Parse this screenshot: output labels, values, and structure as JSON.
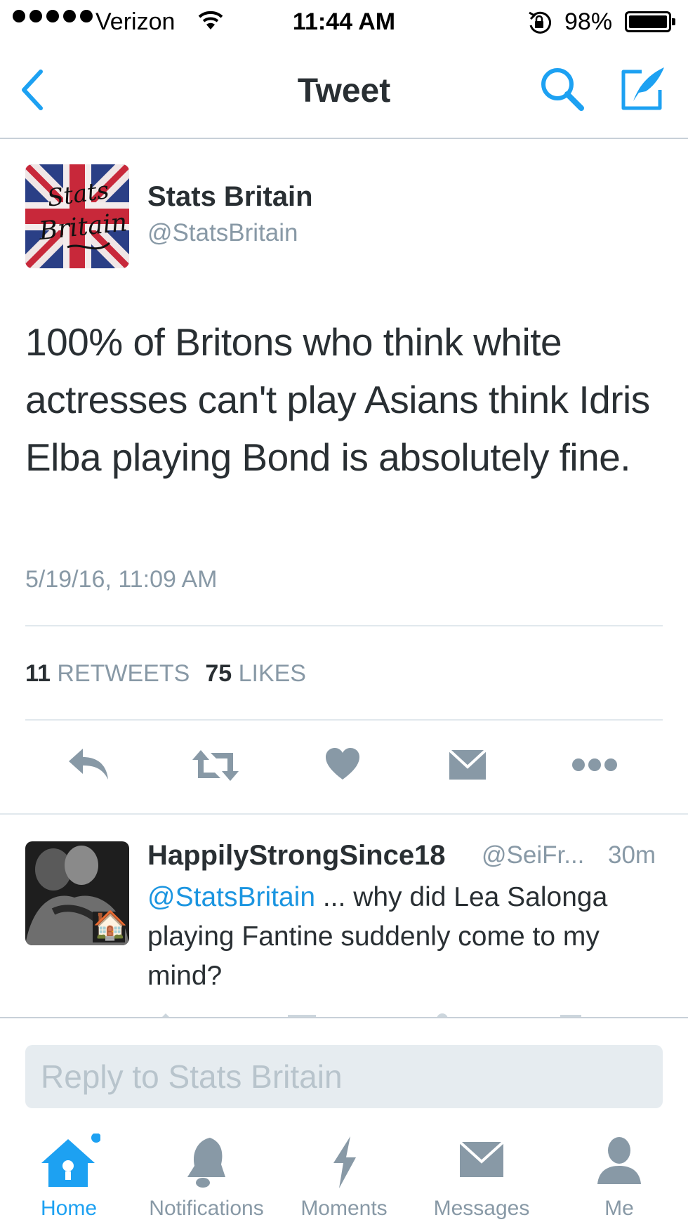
{
  "status_bar": {
    "carrier": "Verizon",
    "time": "11:44 AM",
    "battery": "98%"
  },
  "nav": {
    "title": "Tweet",
    "back_icon": "chevron-left-icon",
    "search_icon": "search-icon",
    "compose_icon": "compose-icon"
  },
  "tweet": {
    "avatar_lettering": "Stats Britain",
    "name": "Stats Britain",
    "handle": "@StatsBritain",
    "text": "100% of Britons who think white actresses can't play Asians think Idris Elba playing Bond is absolutely fine.",
    "timestamp": "5/19/16, 11:09 AM",
    "retweets_count": "11",
    "retweets_label": "RETWEETS",
    "likes_count": "75",
    "likes_label": "LIKES"
  },
  "reply": {
    "name": "HappilyStrongSince18",
    "handle": "@SeiFr...",
    "time": "30m",
    "mention": "@StatsBritain",
    "text": " ... why did Lea Salonga playing Fantine suddenly come to my mind?",
    "avatar_emoji": "🏠"
  },
  "reply_box": {
    "placeholder": "Reply to Stats Britain"
  },
  "tabs": [
    {
      "label": "Home",
      "icon": "home-icon",
      "active": true
    },
    {
      "label": "Notifications",
      "icon": "bell-icon",
      "active": false
    },
    {
      "label": "Moments",
      "icon": "lightning-icon",
      "active": false
    },
    {
      "label": "Messages",
      "icon": "envelope-icon",
      "active": false
    },
    {
      "label": "Me",
      "icon": "person-icon",
      "active": false
    }
  ],
  "colors": {
    "accent": "#1da1f2",
    "text": "#292f33",
    "muted": "#8899a6",
    "divider": "#e1e8ed"
  }
}
